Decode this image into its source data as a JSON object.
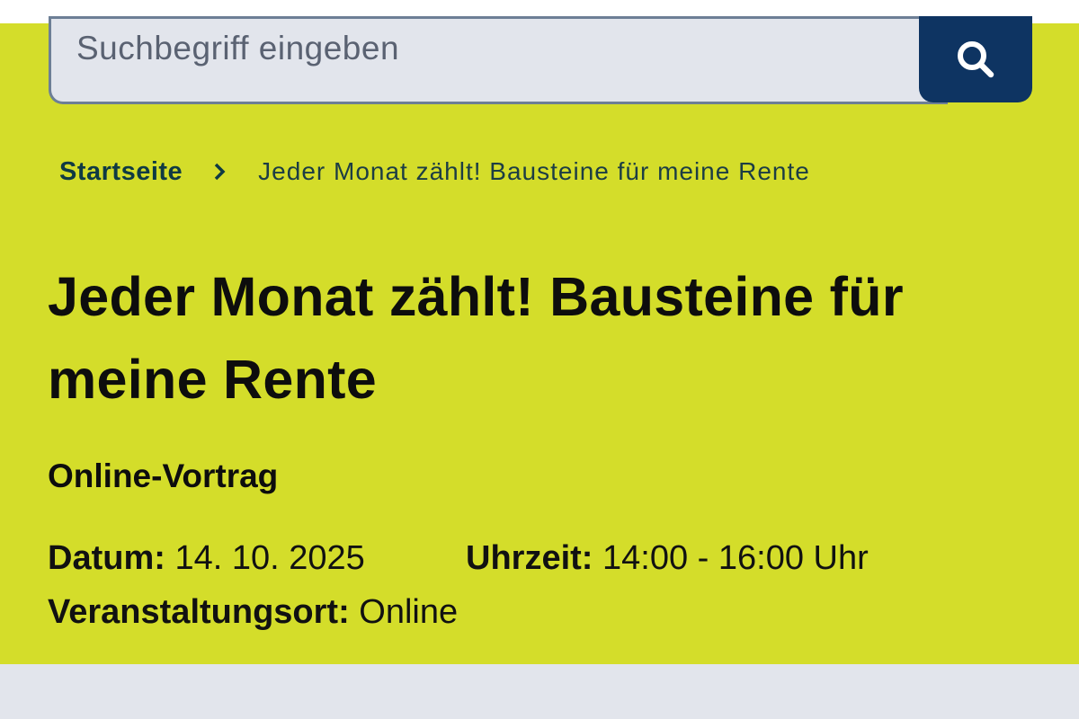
{
  "search": {
    "placeholder": "Suchbegriff eingeben",
    "button_icon": "search-icon"
  },
  "breadcrumb": {
    "home": "Startseite",
    "separator_icon": "chevron-right-icon",
    "current": "Jeder Monat zählt! Bausteine für meine Rente"
  },
  "event": {
    "title": "Jeder Monat zählt! Bausteine für meine Rente",
    "type": "Online-Vortrag",
    "date_label": "Datum:",
    "date_value": "14. 10. 2025",
    "time_label": "Uhrzeit:",
    "time_value": "14:00 - 16:00 Uhr",
    "place_label": "Veranstaltungsort:",
    "place_value": "Online"
  },
  "colors": {
    "hero_background": "#d4dd2a",
    "search_button": "#0e3462",
    "input_background": "#e2e5ec",
    "breadcrumb_text": "#0f3a43"
  }
}
